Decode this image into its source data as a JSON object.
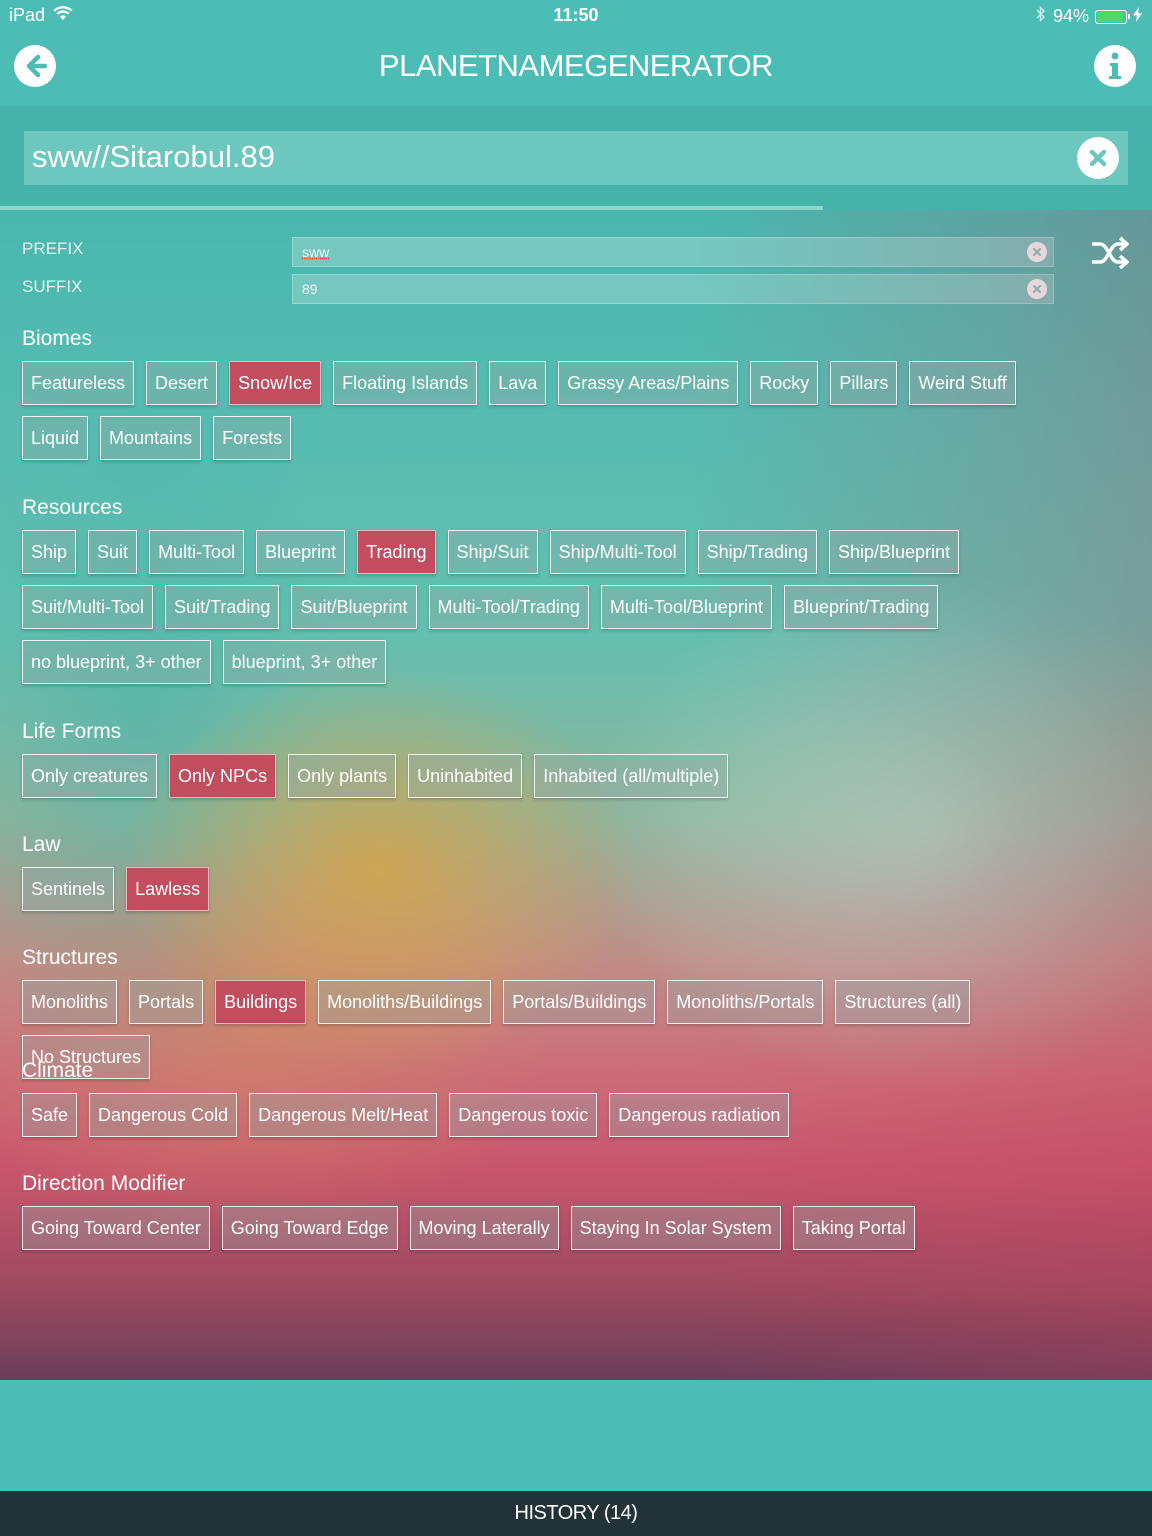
{
  "status": {
    "device": "iPad",
    "time": "11:50",
    "battery": "94%",
    "battery_level": 0.94
  },
  "header": {
    "title": "PLANETNAMEGENERATOR"
  },
  "name": {
    "value": "sww//Sitarobul.89"
  },
  "generation_progress": 0.714,
  "fields": {
    "prefix": {
      "label": "PREFIX",
      "value": "sww"
    },
    "suffix": {
      "label": "SUFFIX",
      "value": "89"
    }
  },
  "sections": [
    {
      "id": "biomes",
      "title": "Biomes",
      "options": [
        {
          "label": "Featureless",
          "selected": false
        },
        {
          "label": "Desert",
          "selected": false
        },
        {
          "label": "Snow/Ice",
          "selected": true
        },
        {
          "label": "Floating Islands",
          "selected": false
        },
        {
          "label": "Lava",
          "selected": false
        },
        {
          "label": "Grassy Areas/Plains",
          "selected": false
        },
        {
          "label": "Rocky",
          "selected": false
        },
        {
          "label": "Pillars",
          "selected": false
        },
        {
          "label": "Weird Stuff",
          "selected": false
        },
        {
          "label": "Liquid",
          "selected": false
        },
        {
          "label": "Mountains",
          "selected": false
        },
        {
          "label": "Forests",
          "selected": false
        }
      ]
    },
    {
      "id": "resources",
      "title": "Resources",
      "options": [
        {
          "label": "Ship",
          "selected": false
        },
        {
          "label": "Suit",
          "selected": false
        },
        {
          "label": "Multi-Tool",
          "selected": false
        },
        {
          "label": "Blueprint",
          "selected": false
        },
        {
          "label": "Trading",
          "selected": true
        },
        {
          "label": "Ship/Suit",
          "selected": false
        },
        {
          "label": "Ship/Multi-Tool",
          "selected": false
        },
        {
          "label": "Ship/Trading",
          "selected": false
        },
        {
          "label": "Ship/Blueprint",
          "selected": false
        },
        {
          "label": "Suit/Multi-Tool",
          "selected": false
        },
        {
          "label": "Suit/Trading",
          "selected": false
        },
        {
          "label": "Suit/Blueprint",
          "selected": false
        },
        {
          "label": "Multi-Tool/Trading",
          "selected": false
        },
        {
          "label": "Multi-Tool/Blueprint",
          "selected": false
        },
        {
          "label": "Blueprint/Trading",
          "selected": false
        },
        {
          "label": "no blueprint, 3+ other",
          "selected": false
        },
        {
          "label": "blueprint, 3+ other",
          "selected": false
        }
      ]
    },
    {
      "id": "life-forms",
      "title": "Life Forms",
      "options": [
        {
          "label": "Only creatures",
          "selected": false
        },
        {
          "label": "Only NPCs",
          "selected": true
        },
        {
          "label": "Only plants",
          "selected": false
        },
        {
          "label": "Uninhabited",
          "selected": false
        },
        {
          "label": "Inhabited (all/multiple)",
          "selected": false
        }
      ]
    },
    {
      "id": "law",
      "title": "Law",
      "options": [
        {
          "label": "Sentinels",
          "selected": false
        },
        {
          "label": "Lawless",
          "selected": true
        }
      ]
    },
    {
      "id": "structures",
      "title": "Structures",
      "options": [
        {
          "label": "Monoliths",
          "selected": false
        },
        {
          "label": "Portals",
          "selected": false
        },
        {
          "label": "Buildings",
          "selected": true
        },
        {
          "label": "Monoliths/Buildings",
          "selected": false
        },
        {
          "label": "Portals/Buildings",
          "selected": false
        },
        {
          "label": "Monoliths/Portals",
          "selected": false
        },
        {
          "label": "Structures (all)",
          "selected": false
        },
        {
          "label": "No Structures",
          "selected": false
        }
      ]
    },
    {
      "id": "climate",
      "title": "Climate",
      "options": [
        {
          "label": "Safe",
          "selected": false
        },
        {
          "label": "Dangerous Cold",
          "selected": false
        },
        {
          "label": "Dangerous Melt/Heat",
          "selected": false
        },
        {
          "label": "Dangerous toxic",
          "selected": false
        },
        {
          "label": "Dangerous radiation",
          "selected": false
        }
      ]
    },
    {
      "id": "direction-modifier",
      "title": "Direction Modifier",
      "options": [
        {
          "label": "Going Toward Center",
          "selected": false
        },
        {
          "label": "Going Toward Edge",
          "selected": false
        },
        {
          "label": "Moving Laterally",
          "selected": false
        },
        {
          "label": "Staying In Solar System",
          "selected": false
        },
        {
          "label": "Taking Portal",
          "selected": false
        }
      ]
    }
  ],
  "history": {
    "label": "HISTORY (14)"
  },
  "icons": [
    "wifi-icon",
    "bluetooth-icon",
    "battery-icon",
    "charging-icon",
    "back-arrow-icon",
    "info-icon",
    "clear-icon",
    "shuffle-icon"
  ],
  "colors": {
    "accent": "#4cbdb5",
    "selected_chip": "#c24d5e",
    "history_bar": "#213238"
  }
}
